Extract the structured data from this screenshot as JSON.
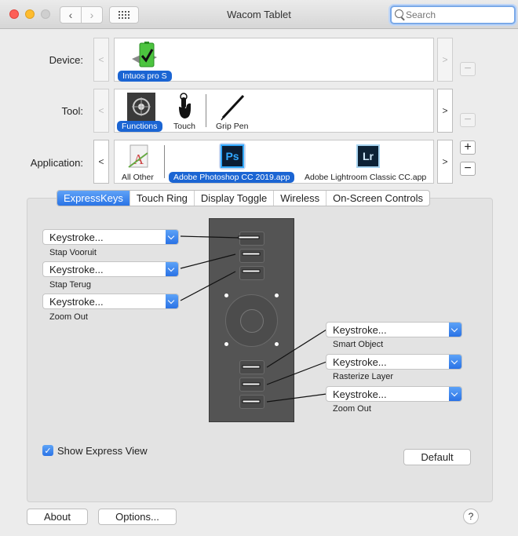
{
  "window": {
    "title": "Wacom Tablet"
  },
  "search": {
    "placeholder": "Search"
  },
  "device": {
    "label": "Device:",
    "items": [
      {
        "name": "Intuos pro S",
        "selected": true
      }
    ]
  },
  "tool": {
    "label": "Tool:",
    "items": [
      {
        "name": "Functions",
        "selected": true
      },
      {
        "name": "Touch",
        "selected": false
      },
      {
        "name": "Grip Pen",
        "selected": false
      }
    ]
  },
  "application": {
    "label": "Application:",
    "items": [
      {
        "name": "All Other",
        "selected": false
      },
      {
        "name": "Adobe Photoshop CC 2019.app",
        "selected": true,
        "icon_text": "Ps"
      },
      {
        "name": "Adobe Lightroom Classic CC.app",
        "selected": false,
        "icon_text": "Lr"
      }
    ]
  },
  "tabs": [
    {
      "label": "ExpressKeys",
      "selected": true
    },
    {
      "label": "Touch Ring",
      "selected": false
    },
    {
      "label": "Display Toggle",
      "selected": false
    },
    {
      "label": "Wireless",
      "selected": false
    },
    {
      "label": "On-Screen Controls",
      "selected": false
    }
  ],
  "left_keys": [
    {
      "value": "Keystroke...",
      "caption": "Stap Vooruit"
    },
    {
      "value": "Keystroke...",
      "caption": "Stap Terug"
    },
    {
      "value": "Keystroke...",
      "caption": "Zoom Out"
    }
  ],
  "right_keys": [
    {
      "value": "Keystroke...",
      "caption": "Smart Object"
    },
    {
      "value": "Keystroke...",
      "caption": "Rasterize Layer"
    },
    {
      "value": "Keystroke...",
      "caption": "Zoom Out"
    }
  ],
  "express_view": {
    "label": "Show Express View",
    "checked": true
  },
  "buttons": {
    "default": "Default",
    "about": "About",
    "options": "Options...",
    "help": "?"
  },
  "colors": {
    "accent": "#2a74e6",
    "selection": "#1b65d3"
  }
}
